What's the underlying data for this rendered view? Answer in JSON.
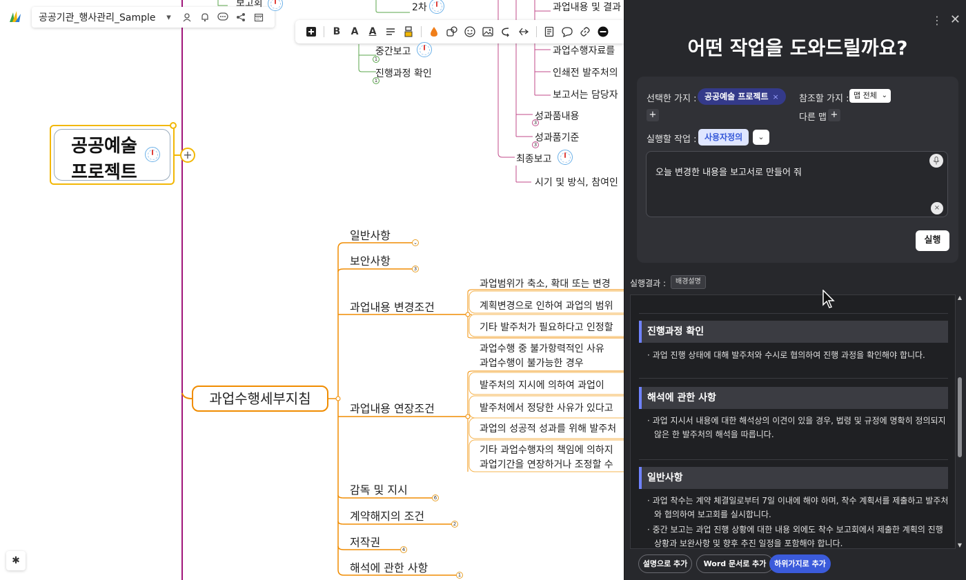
{
  "topbar": {
    "document_title": "공공기관_행사관리_Sample",
    "icons": [
      "user-icon",
      "bell-icon",
      "comment-icon",
      "share-icon",
      "calendar-icon"
    ]
  },
  "toolbar": {
    "bold": "B",
    "font_size": "A",
    "font_color": "A",
    "buttons": [
      "add-node",
      "bold",
      "font-size",
      "font-color",
      "align",
      "format-painter",
      "fill",
      "shape",
      "emoji",
      "image",
      "relation",
      "boundary",
      "note",
      "comment",
      "link",
      "remove"
    ]
  },
  "mindmap": {
    "root": "공공예술 프로젝트",
    "top_nodes": [
      {
        "label": "보고회",
        "badge": ""
      },
      {
        "label": "2차",
        "badge": ""
      },
      {
        "label": "중간보고",
        "badge": "1"
      },
      {
        "label": "진행과정 확인",
        "badge": "1"
      }
    ],
    "right_top_nodes": [
      "과업내용 및 결과",
      "과업수행자료를",
      "인쇄전 발주처의",
      "보고서는 담당자"
    ],
    "deliverables": [
      {
        "label": "성과품내용",
        "badge": "3"
      },
      {
        "label": "성과품기준",
        "badge": "3"
      }
    ],
    "final_report": "최종보고",
    "final_report_child": "시기 및 방식, 참여인",
    "guide_node": "과업수행세부지침",
    "guide_children": [
      {
        "label": "일반사항",
        "badge": "⌄"
      },
      {
        "label": "보안사항",
        "badge": "3"
      },
      {
        "label": "과업내용 변경조건",
        "badge": ""
      },
      {
        "label": "과업내용 연장조건",
        "badge": ""
      },
      {
        "label": "감독 및 지시",
        "badge": "6"
      },
      {
        "label": "계약해지의 조건",
        "badge": "2"
      },
      {
        "label": "저작권",
        "badge": "4"
      },
      {
        "label": "해석에 관한 사항",
        "badge": "1"
      }
    ],
    "change_conditions": [
      "과업범위가 축소, 확대 또는 변경",
      "계획변경으로 인하여 과업의 범위",
      "기타 발주처가 필요하다고 인정할"
    ],
    "extension_conditions": [
      {
        "line1": "과업수행 중 불가항력적인 사유",
        "line2": "과업수행이 불가능한 경우"
      },
      {
        "line1": "발주처의 지시에 의하여 과업이",
        "line2": ""
      },
      {
        "line1": "발주처에서 정당한 사유가 있다고",
        "line2": ""
      },
      {
        "line1": "과업의 성공적 성과를 위해 발주처",
        "line2": ""
      },
      {
        "line1": "기타 과업수행자의 책임에 의하지",
        "line2": "과업기간을 연장하거나 조정할 수"
      }
    ]
  },
  "panel": {
    "title": "어떤 작업을 도와드릴까요?",
    "selected_branch_label": "선택한 가지 :",
    "selected_branch_chip": "공공예술 프로젝트",
    "reference_branch_label": "참조할 가지 :",
    "reference_select": "맵 전체",
    "other_map_label": "다른 맵",
    "task_label": "실행할 작업 :",
    "task_chip": "사용자정의",
    "prompt": "오늘 변경한  내용을 보고서로 만들어 줘",
    "run_button": "실행",
    "result_label": "실행결과 :",
    "result_tag": "배경설명",
    "sections": [
      {
        "heading": "진행과정 확인",
        "bullets": [
          "· 과업 진행 상태에 대해 발주처와 수시로 협의하여 진행 과정을 확인해야 합니다."
        ]
      },
      {
        "heading": "해석에 관한 사항",
        "bullets": [
          "· 과업 지시서 내용에 대한 해석상의 이견이 있을 경우, 법령 및 규정에 명확히 정의되지 않은 한 발주처의 해석을 따릅니다."
        ]
      },
      {
        "heading": "일반사항",
        "bullets": [
          "· 과업 착수는 계약 체결일로부터 7일 이내에 해야 하며, 착수 계획서를 제출하고 발주처와 협의하여 보고회를 실시합니다.",
          "· 중간 보고는 과업 진행 상황에 대한 내용 외에도 착수 보고회에서 제출한 계획의 진행 상황과 보완사항 및 향후 추진 일정을 포함해야 합니다."
        ]
      }
    ],
    "footer": {
      "add_as_description": "설명으로 추가",
      "add_as_word": "Word 문서로 추가",
      "add_as_child": "하위가지로 추가"
    }
  },
  "colors": {
    "root_border": "#f2b705",
    "guide_branch": "#f08c00",
    "pink_branch": "#c04a8a",
    "green_branch": "#5aa64b",
    "main_spine": "#a0157a",
    "panel_bg": "#27282c",
    "accent": "#3b5bdb"
  }
}
